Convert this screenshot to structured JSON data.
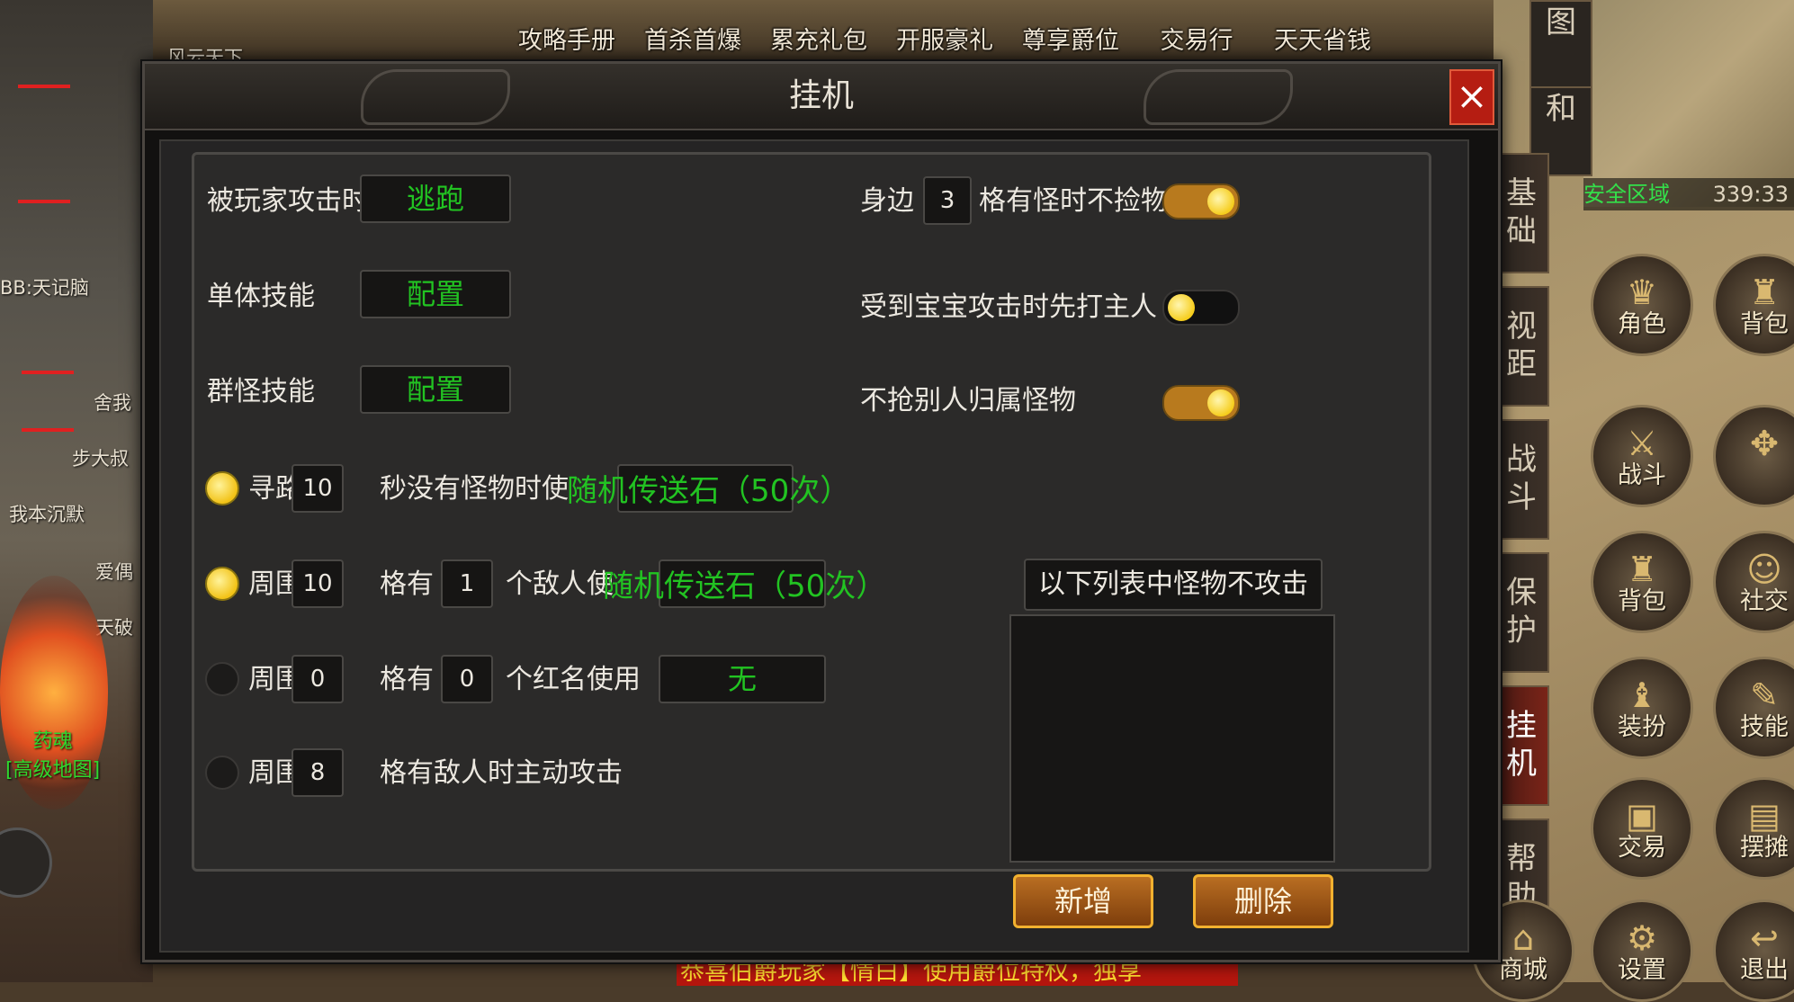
{
  "top_menu": [
    "攻略手册",
    "首杀首爆",
    "累充礼包",
    "开服豪礼",
    "尊享爵位",
    "交易行",
    "天天省钱"
  ],
  "left_names": [
    "风云天下",
    "BB:天记脑",
    "舍我",
    "步大叔",
    "我本沉默",
    "爱偶",
    "天破"
  ],
  "npc": {
    "name": "药魂",
    "subtitle": "[高级地图]"
  },
  "minimap": {
    "zone": "安全区域",
    "coords": "339:33",
    "buttons": [
      "图",
      "和"
    ]
  },
  "side_tabs": [
    "基础",
    "视距",
    "战斗",
    "保护",
    "挂机",
    "帮助"
  ],
  "side_tab_active": "挂机",
  "grid_buttons": [
    "角色",
    "背包",
    "战斗",
    "背包",
    "社交",
    "装扮",
    "技能",
    "交易",
    "摆摊",
    "商城",
    "设置",
    "退出"
  ],
  "notice": "恭喜伯爵玩家【情白】使用爵位特权，独享",
  "dialog": {
    "title": "挂机",
    "close": "×",
    "left": {
      "attacked_label": "被玩家攻击时",
      "attacked_value": "逃跑",
      "single_skill_label": "单体技能",
      "single_skill_value": "配置",
      "group_skill_label": "群怪技能",
      "group_skill_value": "配置",
      "row_pathfind": {
        "enabled": true,
        "prefix": "寻路",
        "seconds": "10",
        "suffix": "秒没有怪物时使",
        "item": "随机传送石（50次）"
      },
      "row_enemy": {
        "enabled": true,
        "prefix": "周围",
        "range": "10",
        "mid": "格有",
        "count": "1",
        "suffix": "个敌人使",
        "item": "随机传送石（50次）"
      },
      "row_red": {
        "enabled": false,
        "prefix": "周围",
        "range": "0",
        "mid": "格有",
        "count": "0",
        "suffix": "个红名使用",
        "item": "无"
      },
      "row_attack": {
        "enabled": false,
        "prefix": "周围",
        "range": "8",
        "suffix": "格有敌人时主动攻击"
      }
    },
    "right": {
      "nearby_prefix": "身边",
      "nearby_value": "3",
      "nearby_suffix": "格有怪时不捡物",
      "nearby_toggle": true,
      "pet_attack_label": "受到宝宝攻击时先打主人",
      "pet_attack_toggle": false,
      "no_steal_label": "不抢别人归属怪物",
      "no_steal_toggle": true,
      "list_header": "以下列表中怪物不攻击",
      "add_button": "新增",
      "delete_button": "删除"
    }
  },
  "colors": {
    "accent_green": "#22c322",
    "close_red": "#b51d12",
    "toggle_on": "#b87a1e",
    "knob_yellow": "#f6cd1c",
    "button_orange": "#b96e22"
  }
}
